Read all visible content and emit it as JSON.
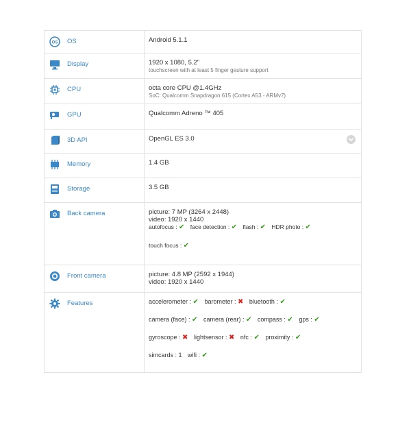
{
  "accent_color": "#3a88c8",
  "ok_color": "#3a9a1e",
  "no_color": "#d8261f",
  "rows": {
    "os": {
      "label": "OS",
      "icon": "os-icon",
      "value": "Android 5.1.1"
    },
    "display": {
      "label": "Display",
      "icon": "monitor-icon",
      "value": "1920 x 1080, 5.2\"",
      "sub": "touchscreen with at least 5 finger gesture support"
    },
    "cpu": {
      "label": "CPU",
      "icon": "chip-icon",
      "value": "octa core CPU @1.4GHz",
      "sub": "SoC: Qualcomm Snapdragon 615 (Cortex A53 - ARMv7)"
    },
    "gpu": {
      "label": "GPU",
      "icon": "gpu-icon",
      "value": "Qualcomm Adreno ™ 405"
    },
    "api3d": {
      "label": "3D API",
      "icon": "cube-icon",
      "value": "OpenGL ES 3.0"
    },
    "memory": {
      "label": "Memory",
      "icon": "memory-icon",
      "value": "1.4 GB"
    },
    "storage": {
      "label": "Storage",
      "icon": "storage-icon",
      "value": "3.5 GB"
    },
    "back_camera": {
      "label": "Back camera",
      "icon": "camera-icon",
      "picture": "picture: 7 MP (3264 x 2448)",
      "video": "video: 1920 x 1440",
      "features": [
        {
          "name": "autofocus :",
          "ok": true
        },
        {
          "name": "face detection :",
          "ok": true
        },
        {
          "name": "flash :",
          "ok": true
        },
        {
          "name": "HDR photo :",
          "ok": true
        },
        {
          "name": "touch focus :",
          "ok": true
        }
      ]
    },
    "front_camera": {
      "label": "Front camera",
      "icon": "front-camera-icon",
      "picture": "picture: 4.8 MP (2592 x 1944)",
      "video": "video: 1920 x 1440"
    },
    "features": {
      "label": "Features",
      "icon": "gear-icon",
      "items": [
        {
          "name": "accelerometer :",
          "ok": true
        },
        {
          "name": "barometer :",
          "ok": false
        },
        {
          "name": "bluetooth :",
          "ok": true
        },
        {
          "name": "camera (face) :",
          "ok": true
        },
        {
          "name": "camera (rear) :",
          "ok": true
        },
        {
          "name": "compass :",
          "ok": true
        },
        {
          "name": "gps :",
          "ok": true
        },
        {
          "name": "gyroscope :",
          "ok": false
        },
        {
          "name": "lightsensor :",
          "ok": false
        },
        {
          "name": "nfc :",
          "ok": true
        },
        {
          "name": "proximity :",
          "ok": true
        },
        {
          "name": "simcards : 1",
          "ok": null
        },
        {
          "name": "wifi :",
          "ok": true
        }
      ]
    }
  }
}
